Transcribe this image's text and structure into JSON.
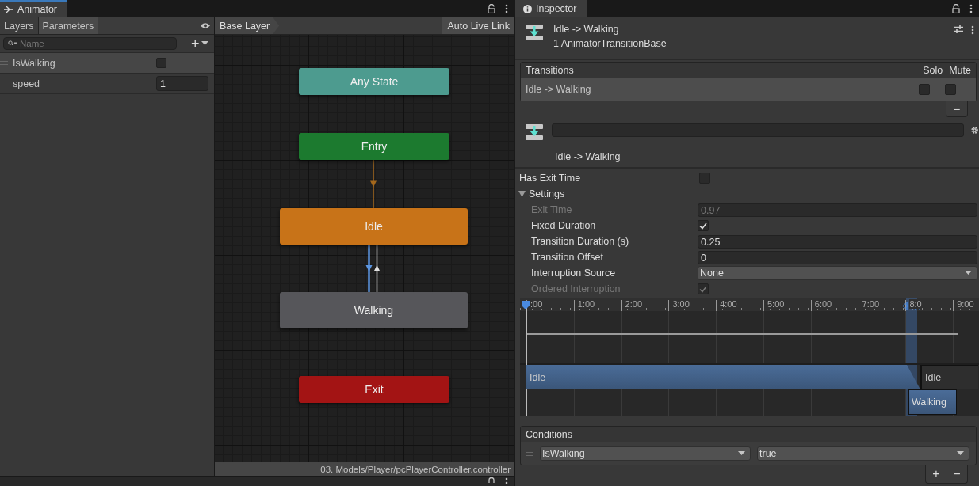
{
  "animator": {
    "tab": "Animator",
    "tabs": [
      {
        "label": "Layers",
        "selected": false
      },
      {
        "label": "Parameters",
        "selected": true
      }
    ],
    "search": {
      "placeholder": "Name"
    },
    "add_button": "+",
    "parameters": [
      {
        "name": "IsWalking",
        "kind": "bool",
        "checked": false,
        "selected": true
      },
      {
        "name": "speed",
        "kind": "float",
        "value": "1",
        "selected": false
      }
    ],
    "breadcrumb": "Base Layer",
    "live_link": "Auto Live Link",
    "states": [
      {
        "name": "Any State",
        "kind": "any"
      },
      {
        "name": "Entry",
        "kind": "entry"
      },
      {
        "name": "Idle",
        "kind": "default"
      },
      {
        "name": "Walking",
        "kind": "normal"
      },
      {
        "name": "Exit",
        "kind": "exit"
      }
    ],
    "transitions": [
      {
        "kind": "default",
        "selected": false
      },
      {
        "kind": "down",
        "selected": true
      },
      {
        "kind": "up",
        "selected": false
      }
    ],
    "status_bar": "03. Models/Player/pcPlayerController.controller"
  },
  "inspector": {
    "tab": "Inspector",
    "title": "Idle -> Walking",
    "subtitle": "1 AnimatorTransitionBase",
    "transitions_list": {
      "header": "Transitions",
      "solo_label": "Solo",
      "mute_label": "Mute",
      "rows": [
        {
          "name": "Idle -> Walking",
          "solo": false,
          "mute": false,
          "selected": true
        }
      ],
      "remove_button": "−"
    },
    "transition_label": "Idle -> Walking",
    "has_exit_time": {
      "label": "Has Exit Time",
      "checked": false
    },
    "settings": {
      "label": "Settings",
      "expanded": true,
      "fields": [
        {
          "label": "Exit Time",
          "kind": "number",
          "value": "0.97",
          "disabled": true
        },
        {
          "label": "Fixed Duration",
          "kind": "checkbox",
          "checked": true,
          "disabled": false
        },
        {
          "label": "Transition Duration (s)",
          "kind": "number",
          "value": "0.25",
          "disabled": false
        },
        {
          "label": "Transition Offset",
          "kind": "number",
          "value": "0",
          "disabled": false
        },
        {
          "label": "Interruption Source",
          "kind": "dropdown",
          "value": "None",
          "disabled": false
        },
        {
          "label": "Ordered Interruption",
          "kind": "checkbox",
          "checked": true,
          "disabled": true
        }
      ]
    },
    "timeline": {
      "ticks": [
        ":00",
        "1:00",
        "2:00",
        "3:00",
        "4:00",
        "5:00",
        "6:00",
        "7:00",
        "8:0",
        "9:00"
      ],
      "clips": [
        {
          "name": "Idle",
          "kind": "source"
        },
        {
          "name": "Idle",
          "kind": "after"
        },
        {
          "name": "Walking",
          "kind": "target"
        }
      ]
    },
    "conditions": {
      "header": "Conditions",
      "rows": [
        {
          "parameter": "IsWalking",
          "value": "true"
        }
      ],
      "add_button": "+",
      "remove_button": "−"
    }
  }
}
